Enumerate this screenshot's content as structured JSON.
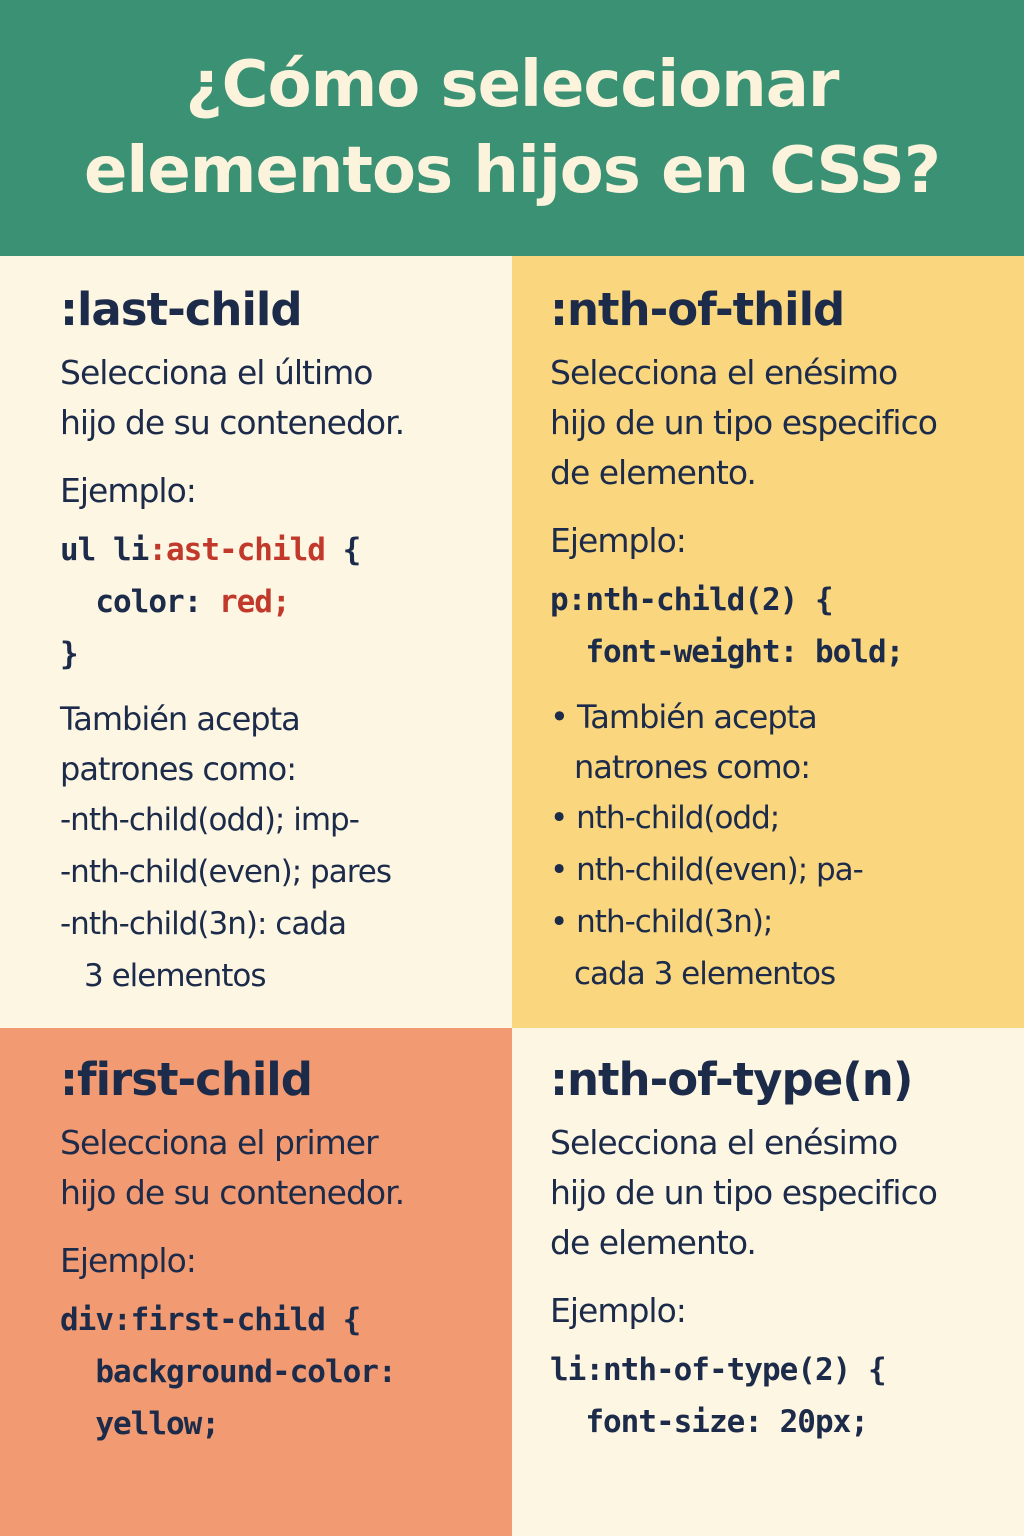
{
  "header": {
    "title_line1": "¿Cómo seleccionar",
    "title_line2": "elementos hijos en CSS?"
  },
  "panels": {
    "last_child": {
      "title": ":last-child",
      "desc_line1": "Selecciona el último",
      "desc_line2": "hijo de su contenedor.",
      "example_label": "Ejemplo:",
      "code_line1_a": "ul li",
      "code_line1_b": ":ast-child",
      "code_line1_c": " {",
      "code_line2_a": "  color: ",
      "code_line2_b": "red;",
      "code_line3": "}",
      "note_line1": "También acepta",
      "note_line2": "patrones como:",
      "patterns": [
        "-nth-child(odd); imp-",
        "-nth-child(even); pares",
        "-nth-child(3n): cada",
        "3 elementos"
      ]
    },
    "nth_of_thild": {
      "title": ":nth-of-thild",
      "desc_line1": "Selecciona el enésimo",
      "desc_line2": "hijo de un tipo especifico",
      "desc_line3": "de elemento.",
      "example_label": "Ejemplo:",
      "code_line1": "p:nth-child(2) {",
      "code_line2": "  font-weight: bold;",
      "note_line1": "También acepta",
      "note_line2": "natrones como:",
      "patterns": [
        "nth-child(odd;",
        "nth-child(even); pa-",
        "nth-child(3n);",
        "cada 3 elementos"
      ]
    },
    "first_child": {
      "title": ":first-child",
      "desc_line1": "Selecciona el primer",
      "desc_line2": "hijo de su contenedor.",
      "example_label": "Ejemplo:",
      "code_line1": "div:first-child {",
      "code_line2": "  background-color:",
      "code_line3": "  yellow;"
    },
    "nth_of_type": {
      "title": ":nth-of-type(n)",
      "desc_line1": "Selecciona el enésimo",
      "desc_line2": "hijo de un tipo especifico",
      "desc_line3": "de elemento.",
      "example_label": "Ejemplo:",
      "code_line1": "li:nth-of-type(2) {",
      "code_line2": "  font-size: 20px;"
    }
  },
  "colors": {
    "header_bg": "#3a9173",
    "header_text": "#fbf3dc",
    "panel_cream": "#fdf6e3",
    "panel_yellow": "#fad67e",
    "panel_salmon": "#f29a72",
    "text_navy": "#1c2b4a",
    "code_red": "#c0392b"
  }
}
